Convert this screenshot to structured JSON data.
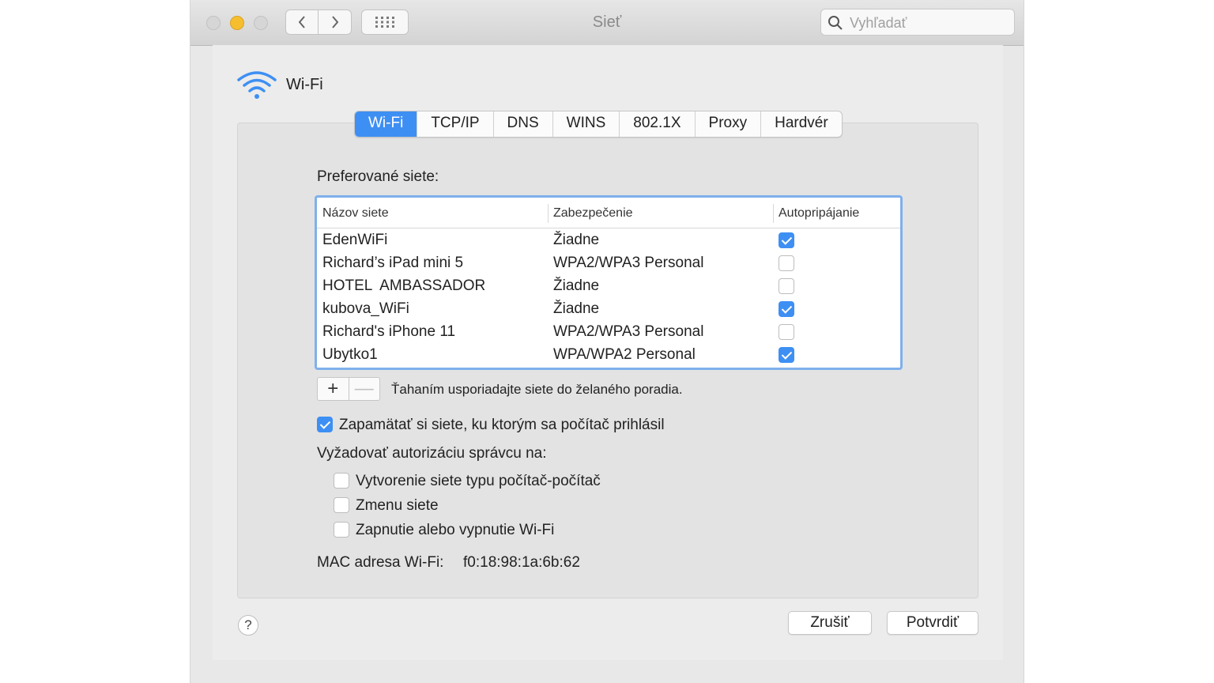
{
  "window": {
    "title": "Sieť",
    "search_placeholder": "Vyhľadať"
  },
  "header": {
    "title": "Wi-Fi"
  },
  "tabs": [
    {
      "label": "Wi-Fi",
      "active": true
    },
    {
      "label": "TCP/IP",
      "active": false
    },
    {
      "label": "DNS",
      "active": false
    },
    {
      "label": "WINS",
      "active": false
    },
    {
      "label": "802.1X",
      "active": false
    },
    {
      "label": "Proxy",
      "active": false
    },
    {
      "label": "Hardvér",
      "active": false
    }
  ],
  "preferred": {
    "label": "Preferované siete:",
    "columns": [
      "Názov siete",
      "Zabezpečenie",
      "Autopripájanie"
    ],
    "rows": [
      {
        "name": "EdenWiFi",
        "security": "Žiadne",
        "auto": true
      },
      {
        "name": "Richard’s iPad mini 5",
        "security": "WPA2/WPA3 Personal",
        "auto": false
      },
      {
        "name": "HOTEL  AMBASSADOR",
        "security": "Žiadne",
        "auto": false
      },
      {
        "name": "kubova_WiFi",
        "security": "Žiadne",
        "auto": true
      },
      {
        "name": "Richard's iPhone 11",
        "security": "WPA2/WPA3 Personal",
        "auto": false
      },
      {
        "name": "Ubytko1",
        "security": "WPA/WPA2 Personal",
        "auto": true
      }
    ],
    "add_label": "+",
    "remove_label": "—",
    "hint": "Ťahaním usporiadajte siete do želaného poradia."
  },
  "remember": {
    "label": "Zapamätať si siete, ku ktorým sa počítač prihlásil",
    "checked": true
  },
  "admin": {
    "label": "Vyžadovať autorizáciu správcu na:",
    "options": [
      {
        "label": "Vytvorenie siete typu počítač-počítač",
        "checked": false
      },
      {
        "label": "Zmenu siete",
        "checked": false
      },
      {
        "label": "Zapnutie alebo vypnutie Wi-Fi",
        "checked": false
      }
    ]
  },
  "mac": {
    "label": "MAC adresa Wi-Fi:",
    "value": "f0:18:98:1a:6b:62"
  },
  "buttons": {
    "help": "?",
    "cancel": "Zrušiť",
    "ok": "Potvrdiť"
  },
  "colors": {
    "accent": "#3e8ff3",
    "focus_ring": "#7fb0ec",
    "minimize": "#f6be2f"
  }
}
